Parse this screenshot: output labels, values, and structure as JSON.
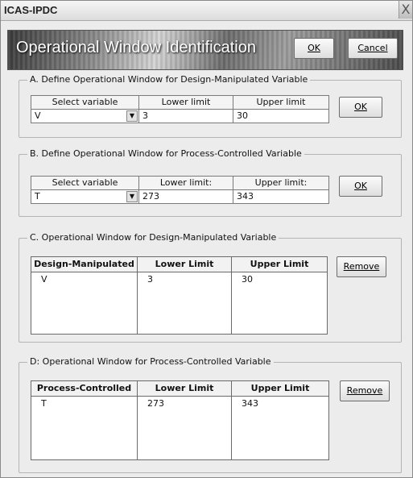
{
  "window": {
    "title": "ICAS-IPDC",
    "close": "X"
  },
  "banner": {
    "title": "Operational Window Identification",
    "ok": "OK",
    "cancel": "Cancel"
  },
  "section_a": {
    "legend": "A. Define Operational Window for Design-Manipulated Variable",
    "headers": [
      "Select variable",
      "Lower limit",
      "Upper limit"
    ],
    "values": {
      "variable": "V",
      "lower": "3",
      "upper": "30"
    },
    "ok": "OK"
  },
  "section_b": {
    "legend": "B. Define Operational Window for Process-Controlled Variable",
    "headers": [
      "Select variable",
      "Lower limit:",
      "Upper limit:"
    ],
    "values": {
      "variable": "T",
      "lower": "273",
      "upper": "343"
    },
    "ok": "OK"
  },
  "section_c": {
    "legend": "C. Operational Window for Design-Manipulated Variable",
    "headers": [
      "Design-Manipulated",
      "Lower Limit",
      "Upper Limit"
    ],
    "rows": [
      {
        "name": "V",
        "lower": "3",
        "upper": "30"
      }
    ],
    "remove": "Remove"
  },
  "section_d": {
    "legend": "D: Operational Window for Process-Controlled Variable",
    "headers": [
      "Process-Controlled",
      "Lower Limit",
      "Upper Limit"
    ],
    "rows": [
      {
        "name": "T",
        "lower": "273",
        "upper": "343"
      }
    ],
    "remove": "Remove"
  }
}
